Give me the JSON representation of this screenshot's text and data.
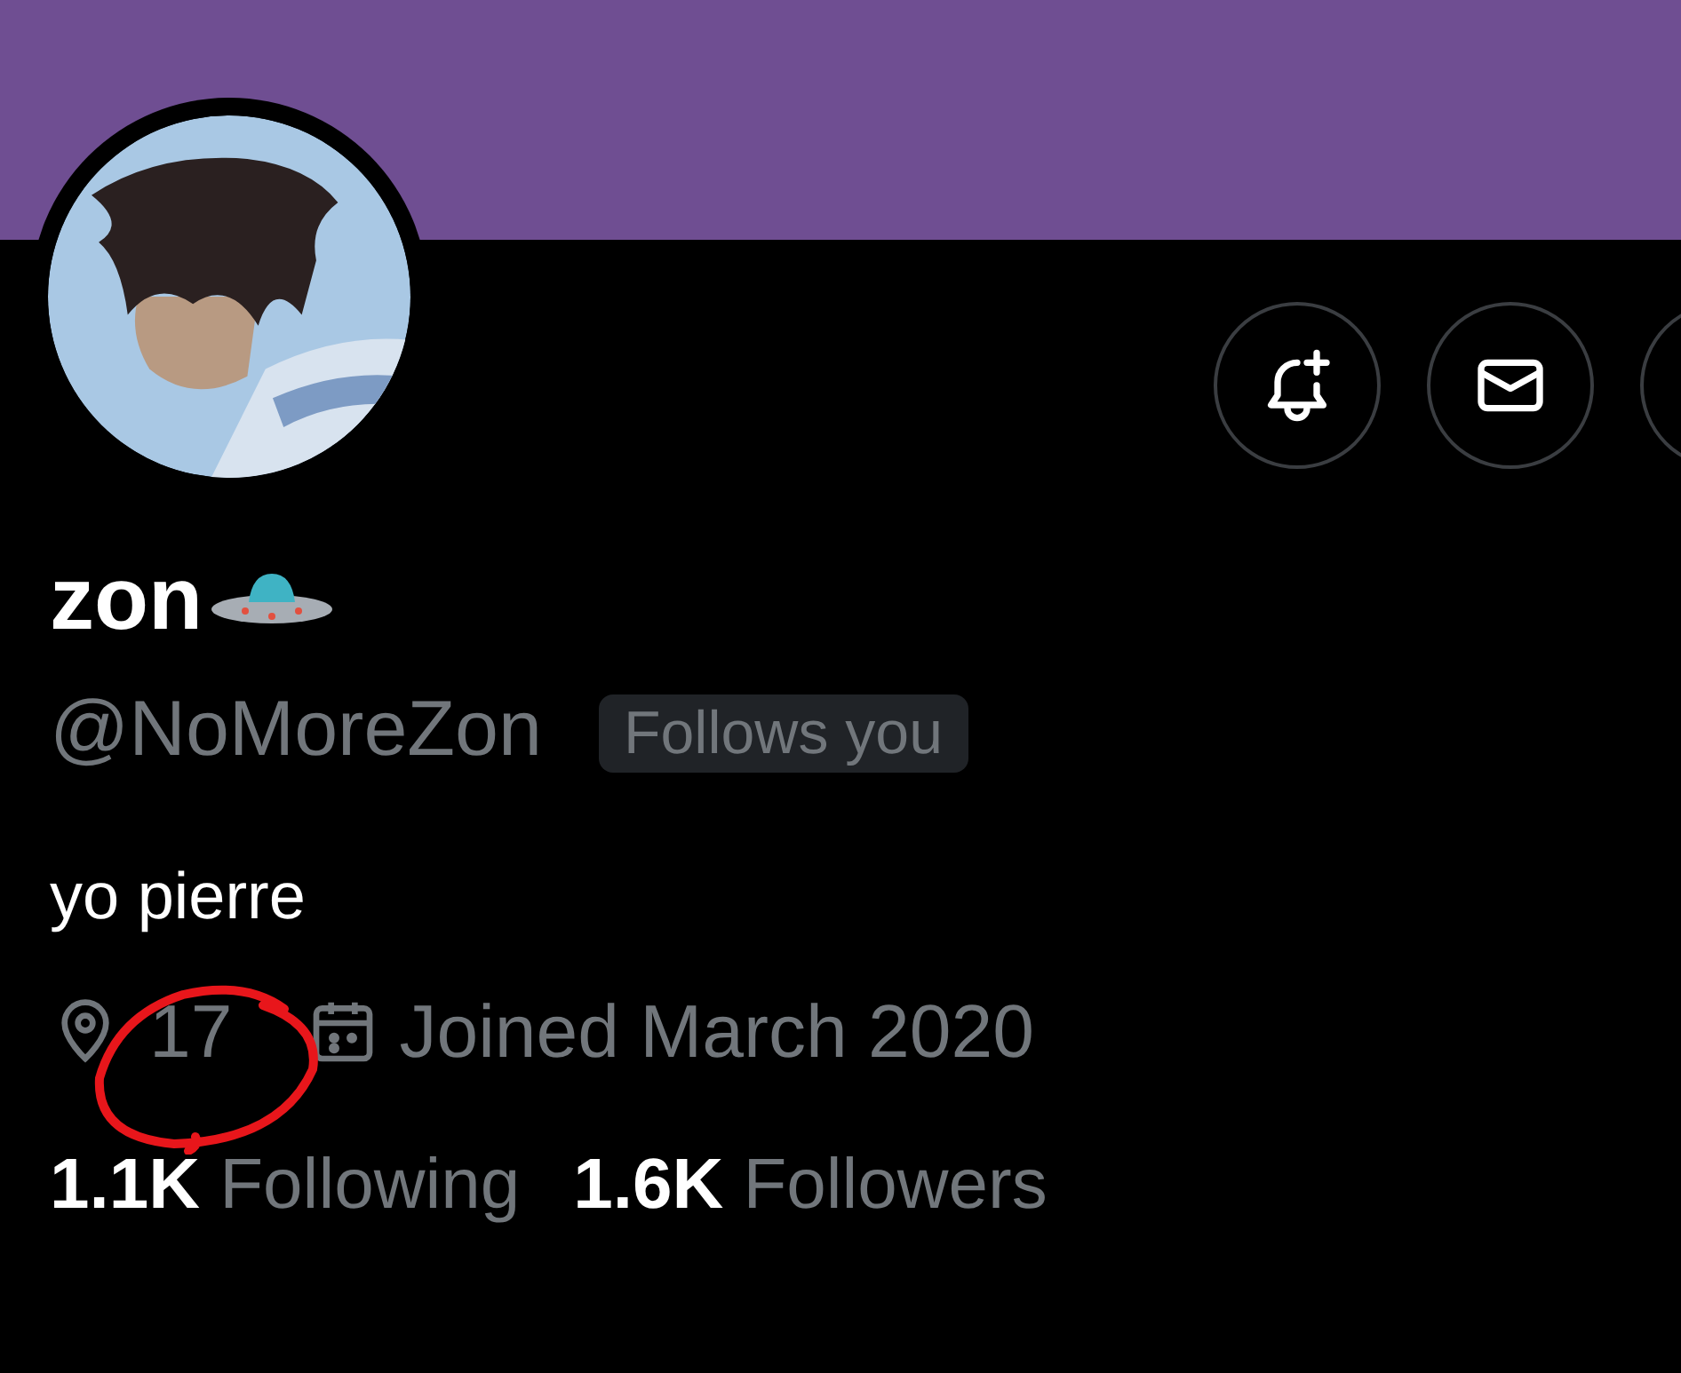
{
  "profile": {
    "name": "zon",
    "handle": "@NoMoreZon",
    "badge": "Follows you",
    "bio": "yo pierre",
    "location": "17",
    "joined": "Joined March 2020"
  },
  "stats": [
    {
      "count": "1.1K",
      "label": "Following"
    },
    {
      "count": "1.6K",
      "label": "Followers"
    }
  ]
}
